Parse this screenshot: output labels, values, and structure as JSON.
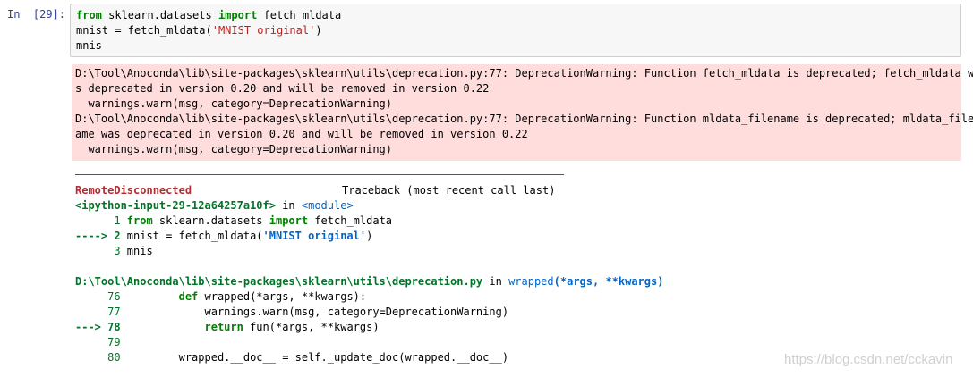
{
  "cell": {
    "prompt": "In  [29]:",
    "input": {
      "l1_from": "from",
      "l1_mod": " sklearn.datasets ",
      "l1_import": "import",
      "l1_rest": " fetch_mldata",
      "l2_pre": "mnist = fetch_mldata(",
      "l2_str": "'MNIST original'",
      "l2_post": ")",
      "l3": "mnis"
    },
    "stderr": [
      "D:\\Tool\\Anoconda\\lib\\site-packages\\sklearn\\utils\\deprecation.py:77: DeprecationWarning: Function fetch_mldata is deprecated; fetch_mldata wa",
      "s deprecated in version 0.20 and will be removed in version 0.22",
      "  warnings.warn(msg, category=DeprecationWarning)",
      "D:\\Tool\\Anoconda\\lib\\site-packages\\sklearn\\utils\\deprecation.py:77: DeprecationWarning: Function mldata_filename is deprecated; mldata_filen",
      "ame was deprecated in version 0.20 and will be removed in version 0.22",
      "  warnings.warn(msg, category=DeprecationWarning)"
    ],
    "traceback": {
      "error_name": "RemoteDisconnected",
      "header_right": "Traceback (most recent call last)",
      "ipython_input": "<ipython-input-29-12a64257a10f>",
      "in_word": " in ",
      "module": "<module>",
      "f1_num": "      1 ",
      "f1_from": "from",
      "f1_mod": " sklearn.datasets ",
      "f1_import": "import",
      "f1_rest": " fetch_mldata",
      "f2_arrow": "----> 2 ",
      "f2_pre": "mnist = fetch_mldata(",
      "f2_str": "'MNIST original'",
      "f2_post": ")",
      "f3_num": "      3 ",
      "f3_code": "mnis",
      "file_path": "D:\\Tool\\Anoconda\\lib\\site-packages\\sklearn\\utils\\deprecation.py",
      "in_word2": " in ",
      "func": "wrapped",
      "func_args": "(*args, **kwargs)",
      "l76_num": "     76 ",
      "l76_indent": "        ",
      "l76_def": "def",
      "l76_rest": " wrapped(*args, **kwargs):",
      "l77_num": "     77 ",
      "l77_code": "            warnings.warn(msg, category=DeprecationWarning)",
      "l78_arrow": "---> 78 ",
      "l78_indent": "            ",
      "l78_return": "return",
      "l78_rest": " fun(*args, **kwargs)",
      "l79_num": "     79 ",
      "l80_num": "     80 ",
      "l80_code": "        wrapped.__doc__ = self._update_doc(wrapped.__doc__)"
    },
    "watermark": "https://blog.csdn.net/cckavin"
  }
}
